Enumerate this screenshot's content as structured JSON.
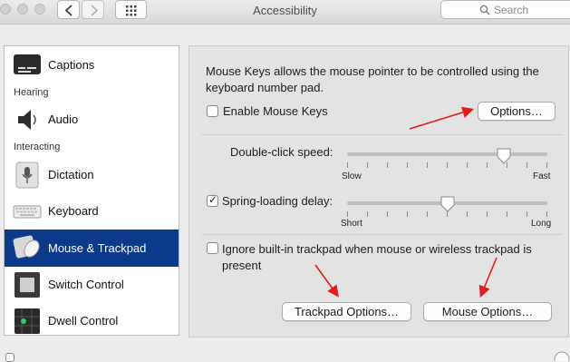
{
  "window": {
    "title": "Accessibility"
  },
  "toolbar": {
    "search_placeholder": "Search"
  },
  "sidebar": {
    "items": [
      {
        "label": "Captions"
      },
      {
        "label": "Audio"
      },
      {
        "label": "Dictation"
      },
      {
        "label": "Keyboard"
      },
      {
        "label": "Mouse & Trackpad",
        "selected": true
      },
      {
        "label": "Switch Control"
      },
      {
        "label": "Dwell Control"
      }
    ],
    "sections": {
      "hearing": "Hearing",
      "interacting": "Interacting"
    }
  },
  "main": {
    "description": "Mouse Keys allows the mouse pointer to be controlled using the keyboard number pad.",
    "enable_mouse_keys": {
      "label": "Enable Mouse Keys",
      "checked": false
    },
    "options_button": "Options…",
    "double_click": {
      "label": "Double-click speed:",
      "min_label": "Slow",
      "max_label": "Fast",
      "value": 0.8
    },
    "spring_loading": {
      "label": "Spring-loading delay:",
      "checked": true,
      "min_label": "Short",
      "max_label": "Long",
      "value": 0.5
    },
    "ignore_trackpad": {
      "label": "Ignore built-in trackpad when mouse or wireless trackpad is present",
      "checked": false
    },
    "trackpad_options_button": "Trackpad Options…",
    "mouse_options_button": "Mouse Options…"
  },
  "colors": {
    "selection": "#0b3a8a",
    "annotation_arrow": "#e31b1b"
  },
  "icons": [
    "chevron-left-icon",
    "chevron-right-icon",
    "grid-icon",
    "search-icon",
    "captions-icon",
    "speaker-icon",
    "microphone-icon",
    "keyboard-icon",
    "mouse-icon",
    "switch-control-icon",
    "dwell-control-icon"
  ]
}
